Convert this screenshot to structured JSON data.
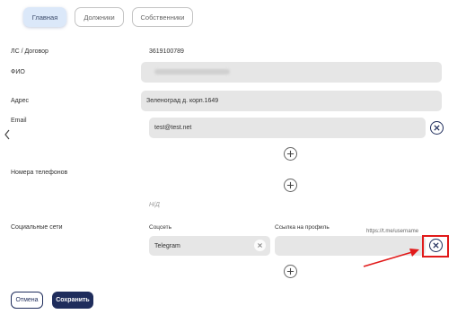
{
  "tabs": [
    "Главная",
    "Должники",
    "Собственники"
  ],
  "contract": {
    "label": "ЛС / Договор",
    "value": "3619100789"
  },
  "fio": {
    "label": "ФИО"
  },
  "address": {
    "label": "Адрес",
    "value": "Зеленоград д. корп.1649"
  },
  "email": {
    "label": "Email",
    "value": "test@test.net"
  },
  "phones": {
    "label": "Номера телефонов",
    "placeholder": "Н/Д"
  },
  "social": {
    "label": "Социальные сети",
    "col_network": "Соцсеть",
    "col_link": "Ссылка на профиль",
    "network_value": "Telegram",
    "link_hint": "https://t.me/username"
  },
  "buttons": {
    "cancel": "Отмена",
    "save": "Сохранить"
  },
  "colors": {
    "primary": "#1f2d5c",
    "annotation": "#e11a1a",
    "tab_active_bg": "#dbe8f9"
  }
}
